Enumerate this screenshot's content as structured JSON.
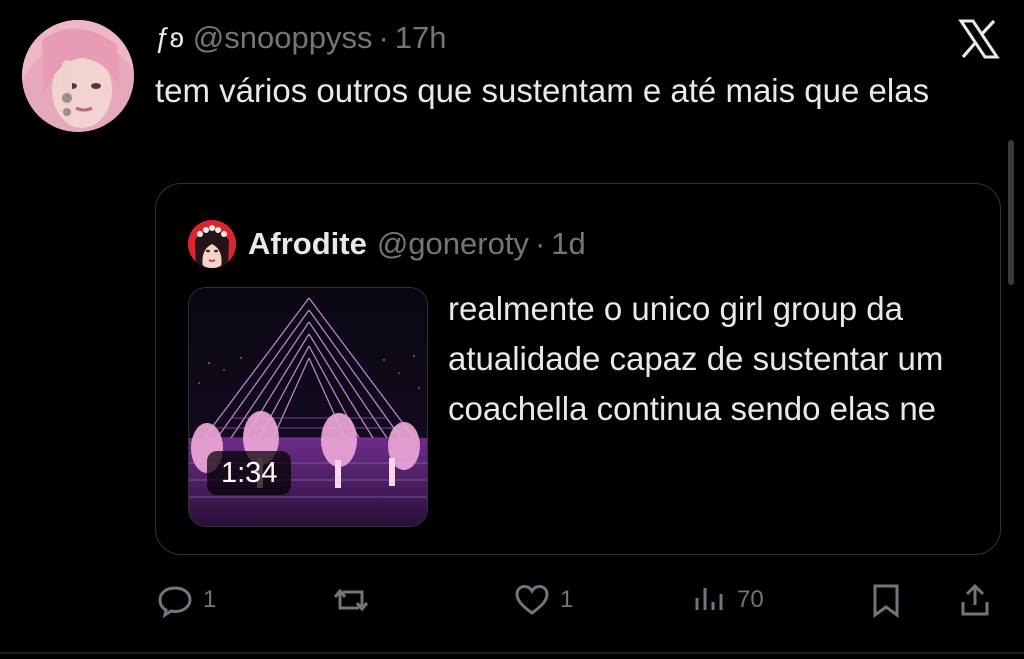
{
  "tweet": {
    "display_name": "ƒʚ",
    "handle": "@snooppyss",
    "separator": "·",
    "time": "17h",
    "text": "tem vários outros que sustentam e até mais que elas"
  },
  "quote": {
    "name": "Afrodite",
    "handle": "@goneroty",
    "separator": "·",
    "time": "1d",
    "media_duration": "1:34",
    "text": "realmente o unico girl group da atualidade capaz de sustentar um coachella continua sendo elas ne"
  },
  "actions": {
    "replies": "1",
    "likes": "1",
    "views": "70"
  },
  "icons": {
    "brand": "x-logo-icon",
    "reply": "reply-icon",
    "retweet": "retweet-icon",
    "like": "heart-icon",
    "views": "views-icon",
    "bookmark": "bookmark-icon",
    "share": "share-icon"
  },
  "colors": {
    "background": "#000000",
    "text": "#e7e9ea",
    "muted": "#71767b",
    "border": "#2f3336"
  }
}
